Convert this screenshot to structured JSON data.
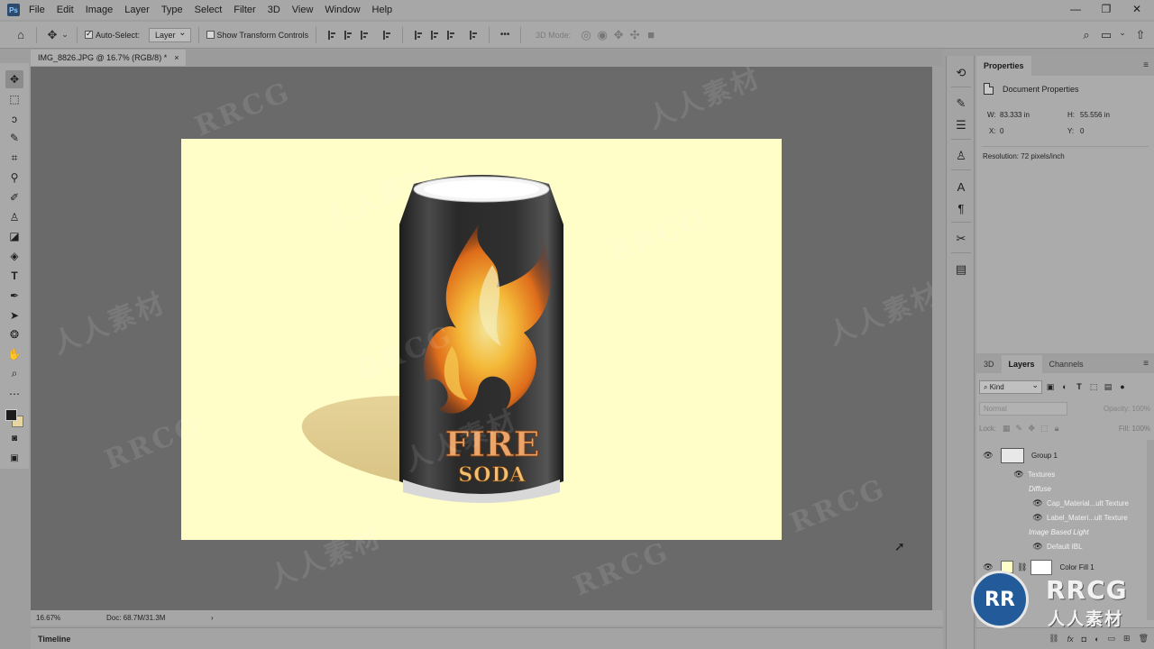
{
  "app": {
    "logo": "Ps"
  },
  "menu": [
    "File",
    "Edit",
    "Image",
    "Layer",
    "Type",
    "Select",
    "Filter",
    "3D",
    "View",
    "Window",
    "Help"
  ],
  "options": {
    "auto_select_label": "Auto-Select:",
    "auto_select_checked": true,
    "auto_select_target": "Layer",
    "transform_label": "Show Transform Controls",
    "more": "•••",
    "mode_label": "3D Mode:"
  },
  "document": {
    "tab_title": "IMG_8826.JPG @ 16.7% (RGB/8) *",
    "close": "×"
  },
  "artwork": {
    "line1": "FIRE",
    "line2": "SODA"
  },
  "watermark": {
    "latin": "RRCG",
    "cjk": "人人素材"
  },
  "status": {
    "zoom": "16.67%",
    "doc": "Doc: 68.7M/31.3M",
    "arrow": "›"
  },
  "timeline": {
    "label": "Timeline"
  },
  "properties": {
    "tab": "Properties",
    "section": "Document Properties",
    "w_label": "W:",
    "w_value": "83.333 in",
    "h_label": "H:",
    "h_value": "55.556 in",
    "x_label": "X:",
    "x_value": "0",
    "y_label": "Y:",
    "y_value": "0",
    "resolution": "Resolution: 72 pixels/inch"
  },
  "layers_panel": {
    "tabs": [
      "3D",
      "Layers",
      "Channels"
    ],
    "active_tab": "Layers",
    "kind": "Kind",
    "blend": "Normal",
    "opacity": "Opacity: 100%",
    "lock": "Lock:",
    "fill": "Fill: 100%",
    "layers": [
      {
        "name": "Group 1",
        "type": "group"
      },
      {
        "name": "Textures",
        "type": "sub"
      },
      {
        "name": "Diffuse",
        "type": "italic"
      },
      {
        "name": "Cap_Material...ult Texture",
        "type": "subsub"
      },
      {
        "name": "Label_Materi...ult Texture",
        "type": "subsub"
      },
      {
        "name": "Image Based Light",
        "type": "italic"
      },
      {
        "name": "Default IBL",
        "type": "subsub"
      },
      {
        "name": "Color Fill 1",
        "type": "fill"
      }
    ]
  },
  "logo_badge": {
    "mark": "RR",
    "text": "RRCG",
    "sub": "人人素材"
  },
  "colors": {
    "document_bg": "#fffdc8",
    "canvas_bg": "#6a6a6a",
    "panel_bg": "#ababab",
    "fg_color": "#1c1c1c",
    "bg_color": "#e8d6a0",
    "can_body": "#2c2c2c",
    "flame": "#f7a21a",
    "label_text": "#e8a868"
  }
}
